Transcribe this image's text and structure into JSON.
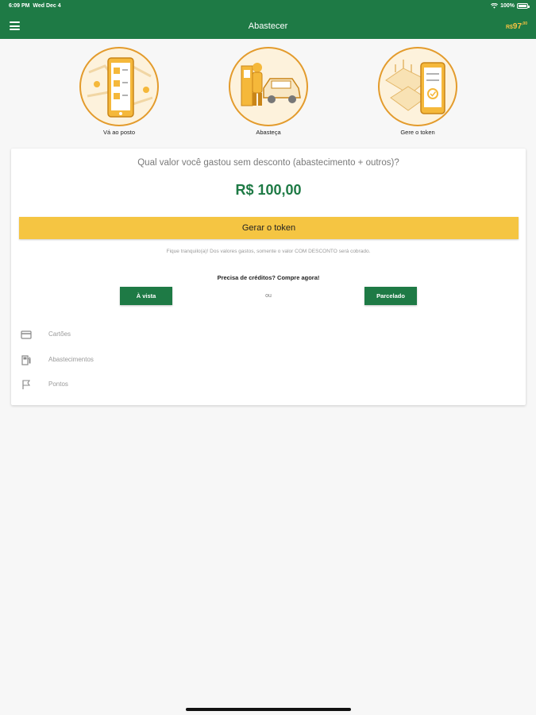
{
  "status_bar": {
    "time": "6:09 PM",
    "date": "Wed Dec 4",
    "battery": "100%"
  },
  "navbar": {
    "title": "Abastecer",
    "balance_currency": "R$",
    "balance_amount": "97",
    "balance_cents": ",00"
  },
  "steps": [
    {
      "label": "Vá ao posto",
      "icon": "phone-map-icon"
    },
    {
      "label": "Abasteça",
      "icon": "fuel-car-icon"
    },
    {
      "label": "Gere o token",
      "icon": "phone-token-icon"
    }
  ],
  "card": {
    "question": "Qual valor você gastou sem desconto (abastecimento + outros)?",
    "amount": "R$ 100,00",
    "token_button": "Gerar o token",
    "note": "Fique tranquilo(a)! Dos valores gastos, somente o valor COM DESCONTO será cobrado.",
    "credits_prompt": "Precisa de créditos? Compre agora!",
    "cash_button": "À vista",
    "or_text": "ou",
    "installment_button": "Parcelado"
  },
  "menu": [
    {
      "label": "Cartões",
      "icon": "card-icon"
    },
    {
      "label": "Abastecimentos",
      "icon": "fuel-pump-icon"
    },
    {
      "label": "Pontos",
      "icon": "flag-icon"
    }
  ],
  "colors": {
    "primary_green": "#1e7a45",
    "accent_yellow": "#f5c542",
    "illustration_orange": "#e39b2c"
  }
}
